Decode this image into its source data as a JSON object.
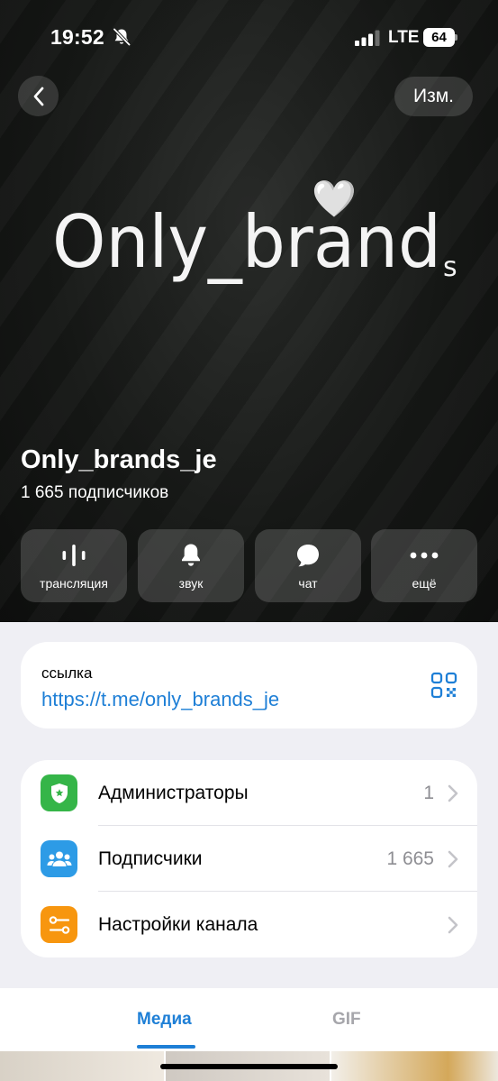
{
  "status_bar": {
    "time": "19:52",
    "network": "LTE",
    "battery": "64",
    "icons": [
      "bell-muted-icon",
      "signal-icon"
    ]
  },
  "header": {
    "back_icon": "chevron-left-icon",
    "edit_label": "Изм."
  },
  "cover": {
    "logo_text": "Only_brand",
    "logo_sub": "s",
    "logo_heart": "🤍"
  },
  "channel": {
    "name": "Only_brands_je",
    "subscribers": "1 665 подписчиков"
  },
  "actions": [
    {
      "label": "трансляция",
      "icon": "waveform-icon"
    },
    {
      "label": "звук",
      "icon": "bell-icon"
    },
    {
      "label": "чат",
      "icon": "chat-bubble-icon"
    },
    {
      "label": "ещё",
      "icon": "more-dots-icon"
    }
  ],
  "link_card": {
    "label": "ссылка",
    "url": "https://t.me/only_brands_je",
    "icon": "qr-code-icon"
  },
  "menu": [
    {
      "label": "Администраторы",
      "value": "1",
      "icon": "admin-badge-icon",
      "color": "#35b548"
    },
    {
      "label": "Подписчики",
      "value": "1 665",
      "icon": "people-icon",
      "color": "#2d9be6"
    },
    {
      "label": "Настройки канала",
      "value": "",
      "icon": "sliders-icon",
      "color": "#f7960f"
    }
  ],
  "tabs": {
    "media": "Медиа",
    "gif": "GIF",
    "active": "media",
    "accent": "#1e7fd6"
  }
}
